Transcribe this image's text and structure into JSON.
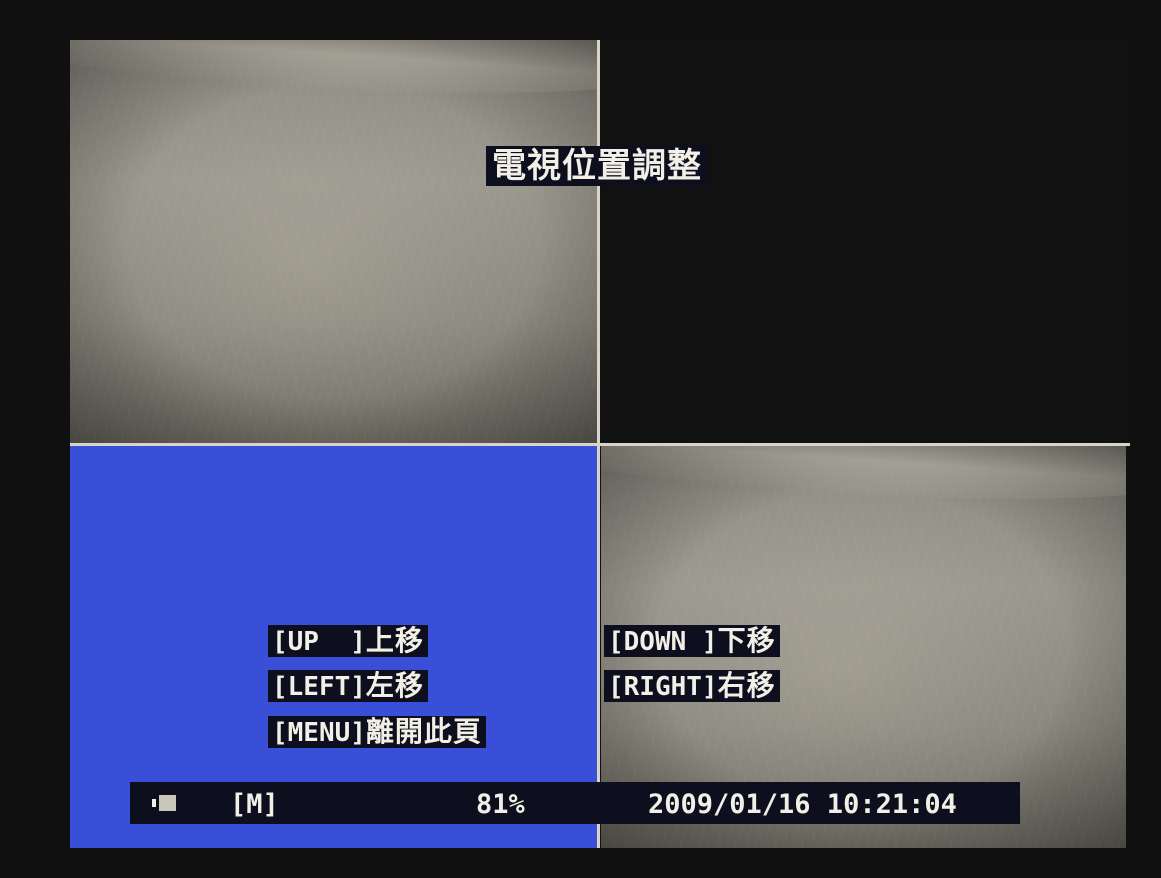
{
  "title": "電視位置調整",
  "commands": {
    "up": {
      "key": "[UP  ]",
      "label": "上移"
    },
    "down": {
      "key": "[DOWN ]",
      "label": "下移"
    },
    "left": {
      "key": "[LEFT]",
      "label": "左移"
    },
    "right": {
      "key": "[RIGHT]",
      "label": "右移"
    },
    "menu": {
      "key": "[MENU]",
      "label": "離開此頁"
    }
  },
  "status": {
    "icon": "recording-indicator-icon",
    "mode": "[M]",
    "level": "81%",
    "datetime": "2009/01/16 10:21:04"
  },
  "colors": {
    "selected_channel": "#3a4fd8",
    "osd_background": "#0d0f1e",
    "osd_text": "#f2efe6",
    "divider": "#d8d4c8"
  }
}
